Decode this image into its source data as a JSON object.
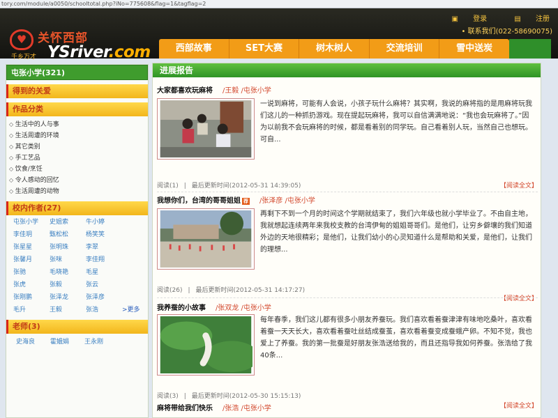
{
  "browser": {
    "url": "tory.com/module/a0050/schooltotal.php?iNo=775608&flag=1&tagflag=2"
  },
  "header": {
    "logo_cn": "关怀西部",
    "logo_slogan": "千乡万才",
    "logo_en_main": "YSriver",
    "logo_en_dot": ".com",
    "login": "登录",
    "register": "注册",
    "contact": "• 联系我们(022-58690075)"
  },
  "nav": [
    "西部故事",
    "SET大赛",
    "树木树人",
    "交流培训",
    "雪中送炭"
  ],
  "sidebar": {
    "school": "屯张小学(321)",
    "care": "得到的关爱",
    "category_title": "作品分类",
    "categories": [
      "生活中的人与事",
      "生活周遭的环境",
      "其它类别",
      "手工艺品",
      "饮食/烹饪",
      "令人感动的回忆",
      "生活周遭的动物"
    ],
    "authors_title": "校内作者(27)",
    "authors": [
      "屯张小学",
      "史姐索",
      "牛小婷",
      "李佳玥",
      "甄松松",
      "杨笑笑",
      "张星星",
      "张明珠",
      "李翠",
      "张馨月",
      "张咪",
      "李佳翔",
      "张驰",
      "毛晓艳",
      "毛星",
      "张虎",
      "张毅",
      "张云",
      "张刚鹏",
      "张泽龙",
      "张泽彦",
      "毛升",
      "王毅",
      "张浩"
    ],
    "more": ">更多",
    "teachers_title": "老师(3)",
    "teachers": [
      "史海良",
      "霍娥娟",
      "王永刚"
    ]
  },
  "main": {
    "header": "进展报告",
    "articles": [
      {
        "title": "大家都喜欢玩麻将",
        "meta": "/王毅   /屯张小学",
        "text": "一说到麻将，可能有人会说，小孩子玩什么麻将？其实啊，我说的麻将指的是用麻将玩我们这儿的一种抓扔游戏。现在提起玩麻将，我可以自信满满地说：“我也会玩麻将了。”因为以前我不会玩麻将的时候，都是看着别的同学玩。自己看着别人玩，当然自己也想玩。可自...",
        "reads": "阅读(1)",
        "updated": "最后更新时间(2012-05-31 14:39:05)",
        "read_full": "【阅读全文】"
      },
      {
        "title": "我想你们，台湾的哥哥姐姐",
        "badge": "荐",
        "meta": "/张泽彦   /屯张小学",
        "text": "再剩下不到一个月的时间这个学期就结束了，我们六年级也就小学毕业了。不由自主地，我就想起连续两年来我校支教的台湾伊甸的姐姐哥哥们。是他们，让穷乡僻壤的我们知道外边的天地很精彩；是他们，让我们幼小的心灵知道什么是帮助和关爱，是他们，让我们的理想...",
        "reads": "阅读(26)",
        "updated": "最后更新时间(2012-05-31 14:17:27)",
        "read_full": "【阅读全文】"
      },
      {
        "title": "我养蚕的小故事",
        "meta": "/张双龙   /屯张小学",
        "text": "每年春季，我们这儿都有很多小朋友养蚕玩。我们喜欢看着蚕津津有味地吃桑叶，喜欢看着蚕一天天长大，喜欢看着蚕吐丝结成蚕茧，喜欢看着蚕变成蚕蛾产卵。不知不觉，我也爱上了养蚕。我的第一批蚕是好朋友张浩送给我的，而且还指导我如何养蚕。张浩给了我40条...",
        "reads": "阅读(3)",
        "updated": "最后更新时间(2012-05-30 15:15:13)",
        "read_full": "【阅读全文】"
      },
      {
        "title": "麻将带给我们快乐",
        "meta": "/张浩   /屯张小学"
      }
    ]
  },
  "colors": {
    "green_header": "#3f9c2d",
    "nav_orange": "#f29c17",
    "meta_red": "#d2452a",
    "link_blue": "#3a7fc1"
  }
}
